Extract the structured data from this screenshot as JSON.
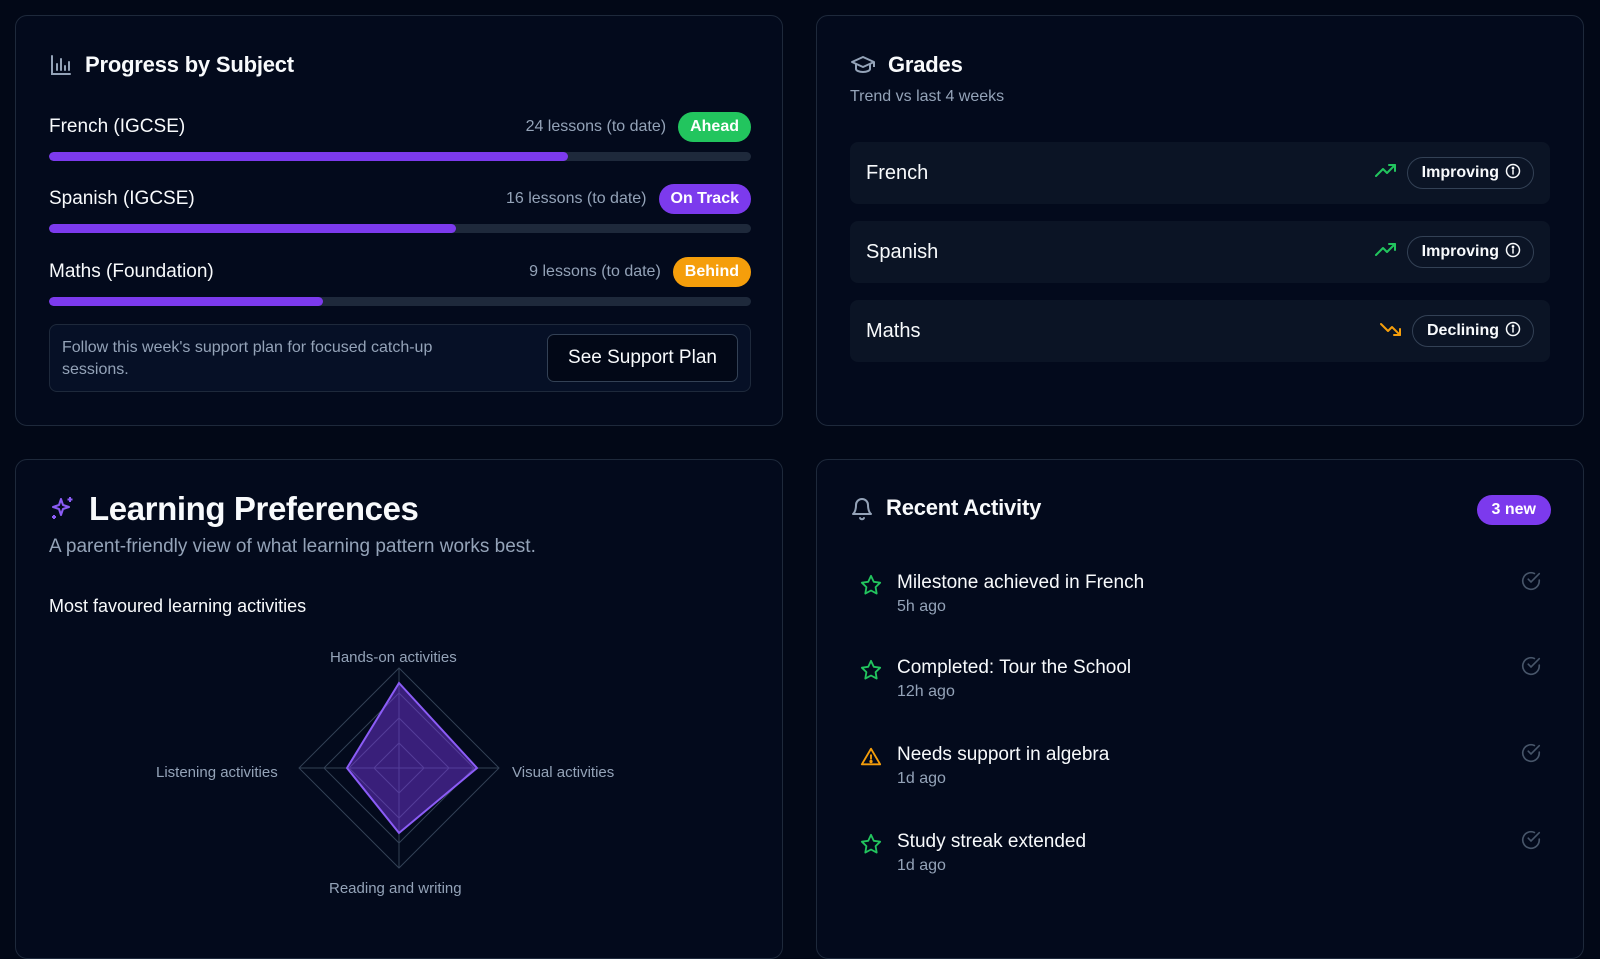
{
  "progress": {
    "title": "Progress by Subject",
    "subjects": [
      {
        "name": "French (IGCSE)",
        "lessons": "24 lessons (to date)",
        "status": "Ahead",
        "progress": 0.74
      },
      {
        "name": "Spanish (IGCSE)",
        "lessons": "16 lessons (to date)",
        "status": "On Track",
        "progress": 0.58
      },
      {
        "name": "Maths (Foundation)",
        "lessons": "9 lessons (to date)",
        "status": "Behind",
        "progress": 0.39
      }
    ],
    "support_text": "Follow this week's support plan for focused catch-up sessions.",
    "support_button": "See Support Plan"
  },
  "grades": {
    "title": "Grades",
    "subtitle": "Trend vs last 4 weeks",
    "rows": [
      {
        "subject": "French",
        "trend": "Improving",
        "direction": "up"
      },
      {
        "subject": "Spanish",
        "trend": "Improving",
        "direction": "up"
      },
      {
        "subject": "Maths",
        "trend": "Declining",
        "direction": "down"
      }
    ]
  },
  "preferences": {
    "title": "Learning Preferences",
    "subtitle": "A parent-friendly view of what learning pattern works best.",
    "section_title": "Most favoured learning activities",
    "chart_data": {
      "type": "radar",
      "axes": [
        "Hands-on activities",
        "Visual activities",
        "Reading and writing",
        "Listening activities"
      ],
      "values": [
        0.85,
        0.78,
        0.65,
        0.52
      ],
      "max": 1
    }
  },
  "activity": {
    "title": "Recent Activity",
    "new_badge": "3 new",
    "items": [
      {
        "title": "Milestone achieved in French",
        "time": "5h ago",
        "icon": "star-icon"
      },
      {
        "title": "Completed: Tour the School",
        "time": "12h ago",
        "icon": "star-icon"
      },
      {
        "title": "Needs support in algebra",
        "time": "1d ago",
        "icon": "warning-icon"
      },
      {
        "title": "Study streak extended",
        "time": "1d ago",
        "icon": "star-icon"
      }
    ]
  },
  "colors": {
    "background": "#020817",
    "accent": "#7c3aed",
    "success": "#22c55e",
    "warning": "#f59e0b"
  }
}
